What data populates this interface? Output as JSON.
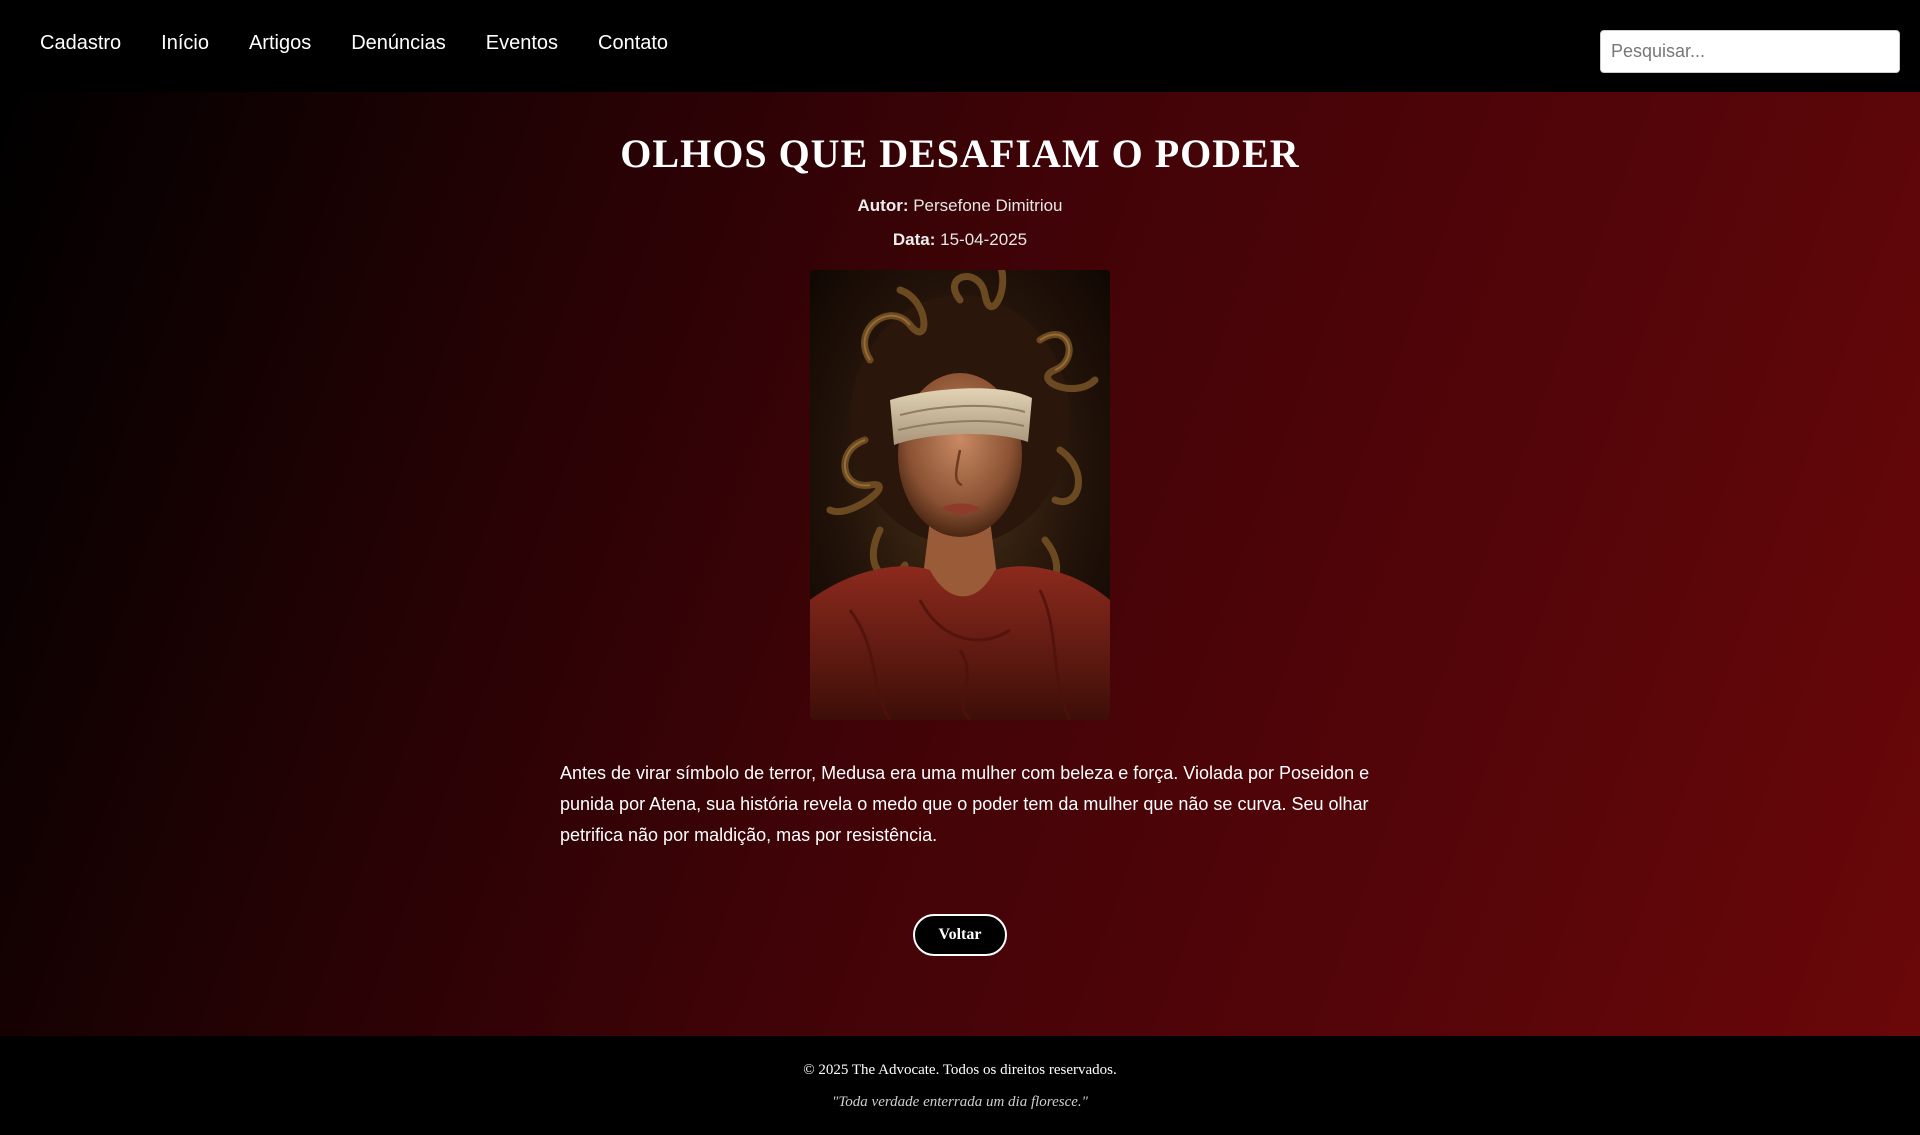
{
  "nav": {
    "links": [
      "Cadastro",
      "Início",
      "Artigos",
      "Denúncias",
      "Eventos",
      "Contato"
    ],
    "search_placeholder": "Pesquisar..."
  },
  "article": {
    "title": "OLHOS QUE DESAFIAM O PODER",
    "author_label": "Autor:",
    "author": "Persefone Dimitriou",
    "date_label": "Data:",
    "date": "15-04-2025",
    "image_subject": "blindfolded-medusa-painting",
    "body": "Antes de virar símbolo de terror, Medusa era uma mulher com beleza e força. Violada por Poseidon e punida por Atena, sua história revela o medo que o poder tem da mulher que não se curva. Seu olhar petrifica não por maldição, mas por resistência.",
    "back_label": "Voltar"
  },
  "footer": {
    "copyright": "© 2025 The Advocate. Todos os direitos reservados.",
    "motto": "\"Toda verdade enterrada um dia floresce.\""
  },
  "colors": {
    "nav_bg": "#000000",
    "gradient_start": "#000000",
    "gradient_end": "#6a0709",
    "text": "#ffffff"
  }
}
